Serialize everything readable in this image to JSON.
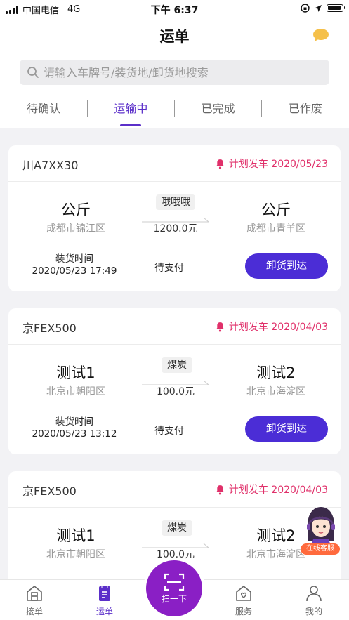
{
  "status_bar": {
    "carrier": "中国电信",
    "network": "4G",
    "time": "下午 6:37"
  },
  "header": {
    "title": "运单"
  },
  "search": {
    "placeholder": "请输入车牌号/装货地/卸货地搜索"
  },
  "tabs": [
    {
      "label": "待确认",
      "active": false
    },
    {
      "label": "运输中",
      "active": true
    },
    {
      "label": "已完成",
      "active": false
    },
    {
      "label": "已作废",
      "active": false
    }
  ],
  "orders": [
    {
      "plate": "川A7XX30",
      "plan": "计划发车 2020/05/23",
      "from": {
        "name": "公斤",
        "area": "成都市锦江区"
      },
      "to": {
        "name": "公斤",
        "area": "成都市青羊区"
      },
      "cargo": "哦哦哦",
      "price": "1200.0元",
      "load_label": "装货时间",
      "load_time": "2020/05/23 17:49",
      "pay_status": "待支付",
      "action": "卸货到达"
    },
    {
      "plate": "京FEX500",
      "plan": "计划发车 2020/04/03",
      "from": {
        "name": "测试1",
        "area": "北京市朝阳区"
      },
      "to": {
        "name": "测试2",
        "area": "北京市海淀区"
      },
      "cargo": "煤炭",
      "price": "100.0元",
      "load_label": "装货时间",
      "load_time": "2020/05/23 13:12",
      "pay_status": "待支付",
      "action": "卸货到达"
    },
    {
      "plate": "京FEX500",
      "plan": "计划发车 2020/04/03",
      "from": {
        "name": "测试1",
        "area": "北京市朝阳区"
      },
      "to": {
        "name": "测试2",
        "area": "北京市海淀区"
      },
      "cargo": "煤炭",
      "price": "100.0元"
    }
  ],
  "service_float": {
    "label": "在线客服"
  },
  "tabbar": {
    "items": [
      {
        "label": "接单",
        "icon": "receive-order-icon"
      },
      {
        "label": "运单",
        "icon": "waybill-icon",
        "active": true
      },
      {
        "label": "扫一下",
        "icon": "scan-icon"
      },
      {
        "label": "服务",
        "icon": "service-house-icon"
      },
      {
        "label": "我的",
        "icon": "profile-icon"
      }
    ]
  },
  "colors": {
    "accent": "#5b2fc9",
    "button": "#4b2dd6",
    "plan": "#e0306a",
    "scan": "#8a1fc5"
  }
}
